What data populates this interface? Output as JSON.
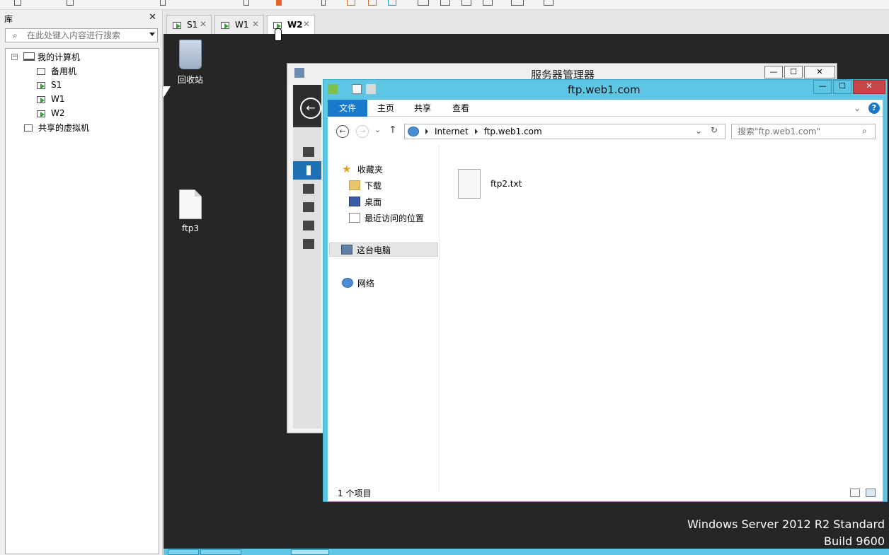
{
  "library": {
    "header": "库",
    "close": "✕",
    "search_placeholder": "在此处键入内容进行搜索",
    "tree": [
      {
        "label": "我的计算机",
        "toggle": "−"
      },
      {
        "label": "备用机"
      },
      {
        "label": "S1"
      },
      {
        "label": "W1"
      },
      {
        "label": "W2"
      },
      {
        "label": "共享的虚拟机"
      }
    ]
  },
  "tabs": [
    {
      "label": "S1",
      "close": "✕"
    },
    {
      "label": "W1",
      "close": "✕"
    },
    {
      "label": "W2",
      "close": "✕"
    }
  ],
  "desktop": {
    "recycle_bin": "回收站",
    "file": "ftp3"
  },
  "server_manager": {
    "title": "服务器管理器",
    "back": "←"
  },
  "explorer": {
    "title": "ftp.web1.com",
    "minimize": "—",
    "maximize": "☐",
    "close": "✕",
    "ribbon": {
      "file": "文件",
      "home": "主页",
      "share": "共享",
      "view": "查看",
      "expand": "⌄",
      "help": "?"
    },
    "address": {
      "back": "←",
      "forward": "→",
      "recent": "⌄",
      "up": "↑",
      "crumbs": [
        "Internet",
        "ftp.web1.com"
      ],
      "dropdown": "⌄",
      "refresh": "↻",
      "search_placeholder": "搜索\"ftp.web1.com\""
    },
    "nav": {
      "favorites": "收藏夹",
      "downloads": "下载",
      "desktop": "桌面",
      "recent": "最近访问的位置",
      "this_pc": "这台电脑",
      "network": "网络"
    },
    "files": [
      {
        "name": "ftp2.txt"
      }
    ],
    "status": "1 个项目"
  },
  "watermark": {
    "line1": "Windows Server 2012 R2 Standard",
    "line2": "Build 9600"
  }
}
